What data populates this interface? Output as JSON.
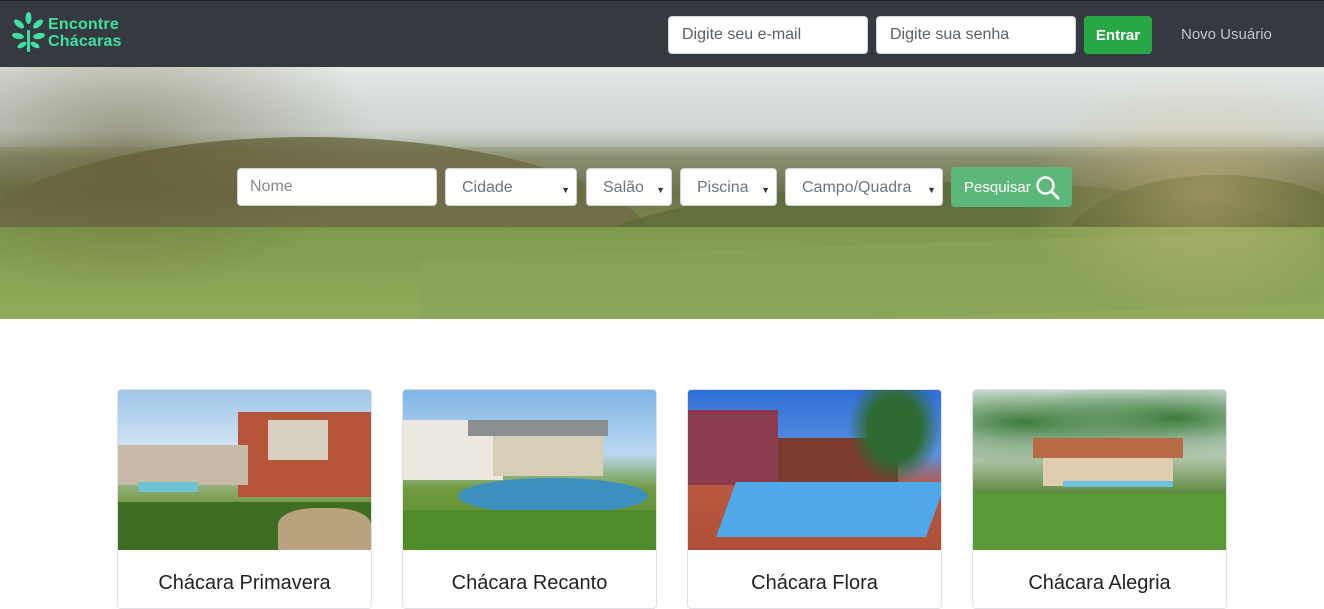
{
  "brand": {
    "line1": "Encontre",
    "line2": "Chácaras",
    "color": "#3fe0a0"
  },
  "login": {
    "email_placeholder": "Digite seu e-mail",
    "password_placeholder": "Digite sua senha",
    "submit_label": "Entrar",
    "new_user_label": "Novo Usuário"
  },
  "search": {
    "name_placeholder": "Nome",
    "city_select": "Cidade",
    "hall_select": "Salão",
    "pool_select": "Piscina",
    "field_select": "Campo/Quadra",
    "submit_label": "Pesquisar"
  },
  "icons": {
    "logo": "tree-logo-icon",
    "search": "search-icon",
    "select_caret": "caret-down-icon"
  },
  "colors": {
    "navbar": "#343a40",
    "primary_green": "#28a745",
    "search_button": "#5cb87a"
  },
  "listings": [
    {
      "title": "Chácara Primavera"
    },
    {
      "title": "Chácara Recanto"
    },
    {
      "title": "Chácara Flora"
    },
    {
      "title": "Chácara Alegria"
    }
  ]
}
